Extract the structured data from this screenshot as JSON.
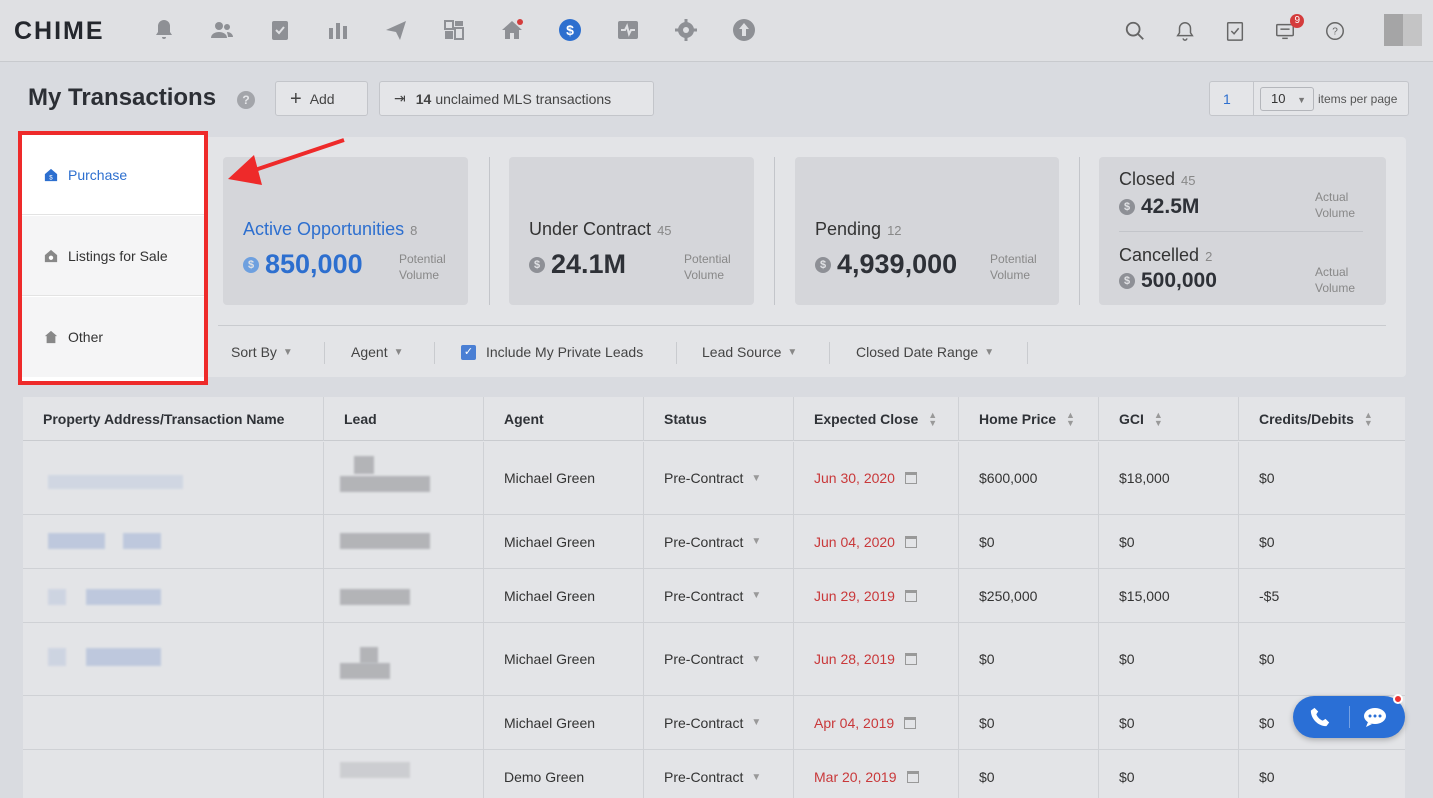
{
  "nav": {
    "logo": "CHIME",
    "notification_badge": "9"
  },
  "header": {
    "title": "My Transactions",
    "help_glyph": "?",
    "add_label": "Add",
    "mls_count": "14",
    "mls_label": "unclaimed MLS transactions",
    "page": "1",
    "per_page": "10",
    "per_page_label": "items per page"
  },
  "side_menu": {
    "items": [
      {
        "label": "Purchase"
      },
      {
        "label": "Listings for Sale"
      },
      {
        "label": "Other"
      }
    ]
  },
  "stats": {
    "active": {
      "title": "Active Opportunities",
      "count": "8",
      "value": "850,000",
      "note1": "Potential",
      "note2": "Volume"
    },
    "under_contract": {
      "title": "Under Contract",
      "count": "45",
      "value": "24.1M",
      "note1": "Potential",
      "note2": "Volume"
    },
    "pending": {
      "title": "Pending",
      "count": "12",
      "value": "4,939,000",
      "note1": "Potential",
      "note2": "Volume"
    },
    "closed": {
      "title": "Closed",
      "count": "45",
      "value": "42.5M",
      "note1": "Actual",
      "note2": "Volume"
    },
    "cancelled": {
      "title": "Cancelled",
      "count": "2",
      "value": "500,000",
      "note1": "Actual",
      "note2": "Volume"
    },
    "dollar_glyph": "$"
  },
  "filters": {
    "sort_by": "Sort By",
    "agent": "Agent",
    "private_leads": "Include My Private Leads",
    "lead_source": "Lead Source",
    "closed_date_range": "Closed Date Range"
  },
  "table": {
    "headers": [
      "Property Address/Transaction Name",
      "Lead",
      "Agent",
      "Status",
      "Expected Close",
      "Home Price",
      "GCI",
      "Credits/Debits"
    ],
    "rows": [
      {
        "agent": "Michael Green",
        "status": "Pre-Contract",
        "close": "Jun 30, 2020",
        "price": "$600,000",
        "gci": "$18,000",
        "credits": "$0"
      },
      {
        "agent": "Michael Green",
        "status": "Pre-Contract",
        "close": "Jun 04, 2020",
        "price": "$0",
        "gci": "$0",
        "credits": "$0"
      },
      {
        "agent": "Michael Green",
        "status": "Pre-Contract",
        "close": "Jun 29, 2019",
        "price": "$250,000",
        "gci": "$15,000",
        "credits": "-$5"
      },
      {
        "agent": "Michael Green",
        "status": "Pre-Contract",
        "close": "Jun 28, 2019",
        "price": "$0",
        "gci": "$0",
        "credits": "$0"
      },
      {
        "agent": "Michael Green",
        "status": "Pre-Contract",
        "close": "Apr 04, 2019",
        "price": "$0",
        "gci": "$0",
        "credits": "$0"
      },
      {
        "agent": "Demo Green",
        "status": "Pre-Contract",
        "close": "Mar 20, 2019",
        "price": "$0",
        "gci": "$0",
        "credits": "$0"
      }
    ]
  },
  "colors": {
    "accent": "#2d6fcf",
    "highlight_border": "#ee2a2a",
    "close_date": "#c9383a"
  }
}
